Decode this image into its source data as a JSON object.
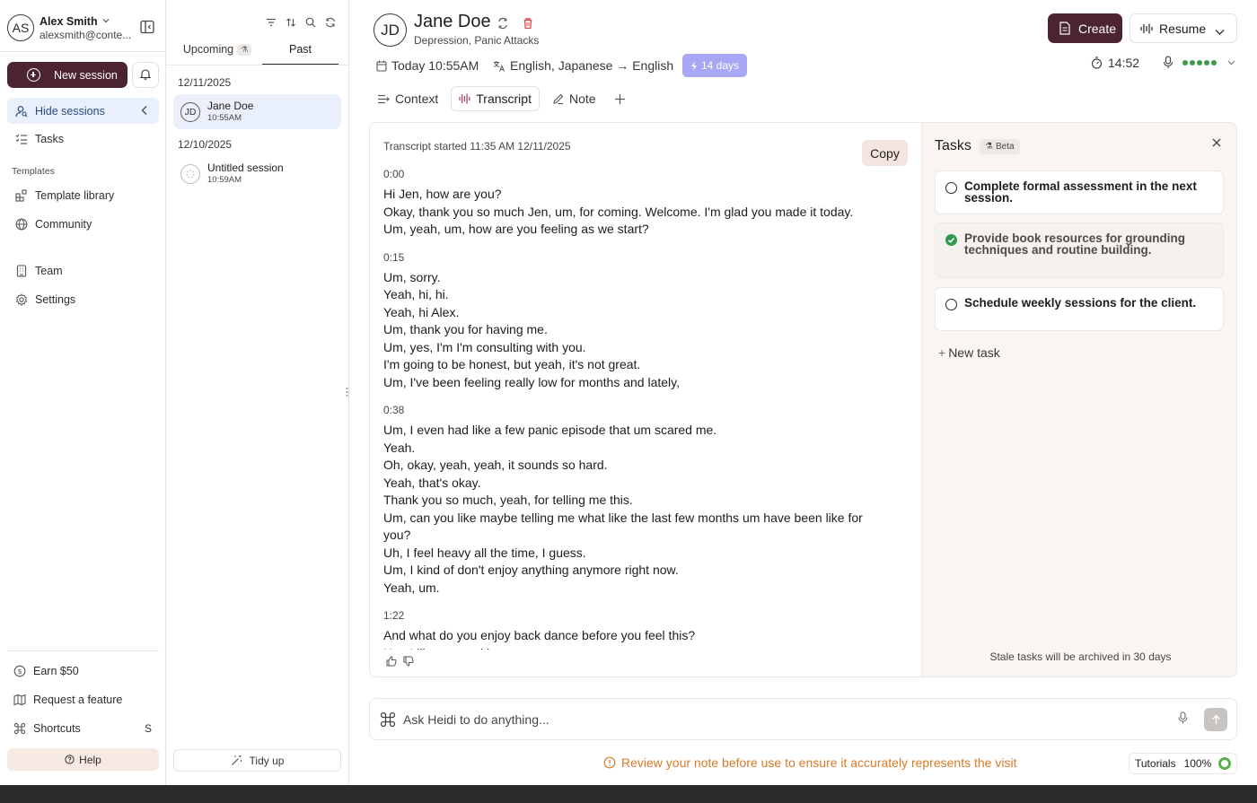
{
  "account": {
    "initials": "AS",
    "name": "Alex Smith",
    "email": "alexsmith@conte..."
  },
  "nav": {
    "new_session": "New session",
    "hide_sessions": "Hide sessions",
    "tasks": "Tasks",
    "templates_heading": "Templates",
    "template_library": "Template library",
    "community": "Community",
    "team": "Team",
    "settings": "Settings",
    "earn": "Earn $50",
    "request_feature": "Request a feature",
    "shortcuts": "Shortcuts",
    "shortcuts_key": "S",
    "help": "Help"
  },
  "sessions": {
    "tab_upcoming": "Upcoming",
    "tab_past": "Past",
    "groups": [
      {
        "date": "12/11/2025",
        "items": [
          {
            "initials": "JD",
            "name": "Jane Doe",
            "time": "10:55AM"
          }
        ]
      },
      {
        "date": "12/10/2025",
        "items": [
          {
            "initials": "",
            "name": "Untitled session",
            "time": "10:59AM"
          }
        ]
      }
    ],
    "tidy_up": "Tidy up"
  },
  "patient": {
    "initials": "JD",
    "name": "Jane Doe",
    "conditions": "Depression, Panic Attacks"
  },
  "header": {
    "create": "Create",
    "resume": "Resume",
    "datetime": "Today 10:55AM",
    "languages": "English, Japanese → English",
    "days": "14 days",
    "timer": "14:52"
  },
  "tabs": {
    "context": "Context",
    "transcript": "Transcript",
    "note": "Note"
  },
  "transcript": {
    "started": "Transcript started 11:35 AM 12/11/2025",
    "copy": "Copy",
    "segments": [
      {
        "time": "0:00",
        "lines": [
          "Hi Jen, how are you?",
          "Okay, thank you so much Jen, um, for coming. Welcome. I'm glad you made it today.",
          "Um, yeah, um, how are you feeling as we start?"
        ]
      },
      {
        "time": "0:15",
        "lines": [
          "Um, sorry.",
          "Yeah, hi, hi.",
          "Yeah, hi Alex.",
          "Um, thank you for having me.",
          "Um, yes, I'm I'm consulting with you.",
          "I'm going to be honest, but yeah, it's not great.",
          "Um, I've been feeling really low for months and lately,"
        ]
      },
      {
        "time": "0:38",
        "lines": [
          "Um, I even had like a few panic episode that um scared me.",
          "Yeah.",
          "Oh, okay, yeah, yeah, it sounds so hard.",
          "Yeah, that's okay.",
          "Thank you so much, yeah, for telling me this.",
          "Um, can you like maybe telling me what like the last few months um have been like for you?",
          "Uh, I feel heavy all the time, I guess.",
          "Um, I kind of don't enjoy anything anymore right now.",
          "Yeah, um."
        ]
      },
      {
        "time": "1:22",
        "lines": [
          "And what do you enjoy back dance before you feel this?",
          "Um, I like um cooking."
        ]
      }
    ]
  },
  "tasks": {
    "title": "Tasks",
    "beta": "Beta",
    "items": [
      {
        "text": "Complete formal assessment in the next session.",
        "done": false
      },
      {
        "text": "Provide book resources for grounding techniques and routine building.",
        "done": true
      },
      {
        "text": "Schedule weekly sessions for the client.",
        "done": false
      }
    ],
    "new_task": "New task",
    "stale_note": "Stale tasks will be archived in 30 days"
  },
  "ask": {
    "placeholder": "Ask Heidi to do anything..."
  },
  "warning": "Review your note before use to ensure it accurately represents the visit",
  "tutorials": {
    "label": "Tutorials",
    "percent": "100%"
  },
  "colors": {
    "brand": "#4b2430",
    "accent_active": "#e9f0fb",
    "days_badge": "#a7a7f4",
    "warning": "#d77a26",
    "success": "#2f9b4d"
  }
}
